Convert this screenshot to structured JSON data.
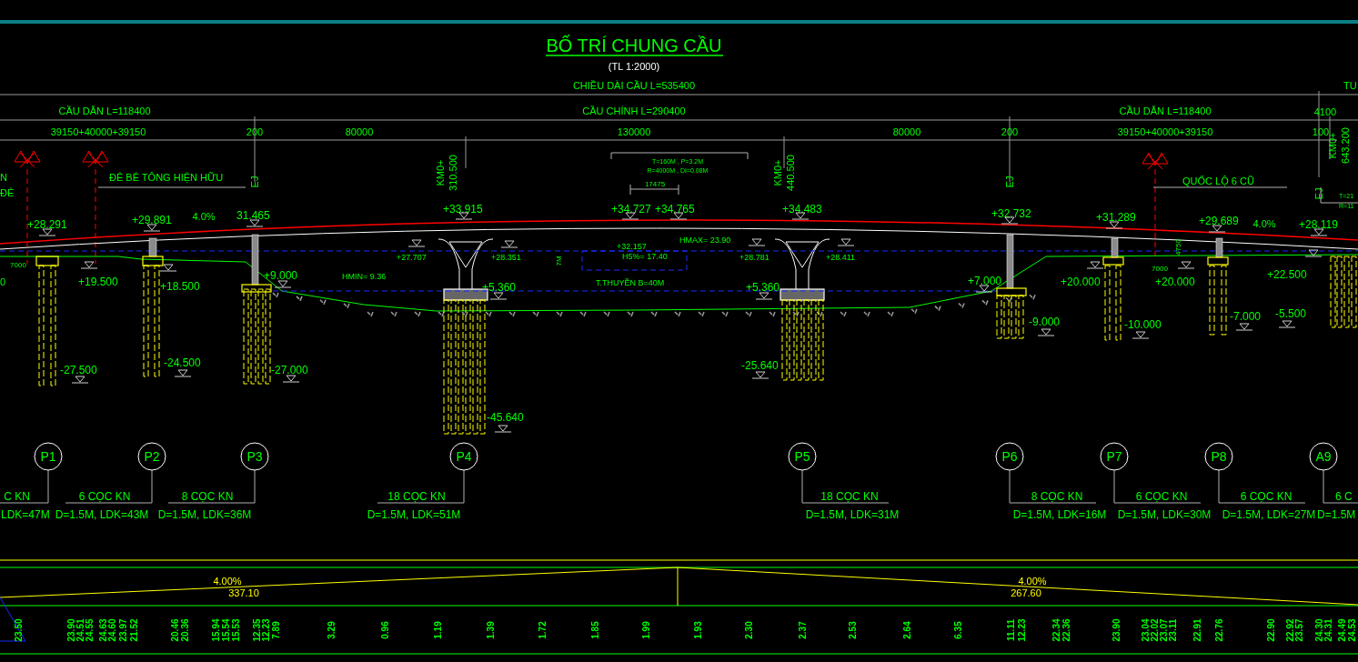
{
  "title": "BỐ TRÍ CHUNG CẦU",
  "scale": "(TL 1:2000)",
  "dimension_texts": [
    "CHIỀU DÀI CẦU L=535400",
    "TU",
    "CẦU DẪN L=118400",
    "CẦU CHÍNH L=290400",
    "CẦU DẪN L=118400",
    "4100",
    "39150+40000+39150",
    "200",
    "80000",
    "130000",
    "80000",
    "200",
    "39150+40000+39150",
    "100"
  ],
  "stations": [
    {
      "prefix": "KM0+",
      "value": "310.500"
    },
    {
      "prefix": "KM0+",
      "value": "440.500"
    },
    {
      "prefix": "KM0+",
      "value": "643.200"
    }
  ],
  "ej_labels": [
    "EJ",
    "EJ",
    "EJ"
  ],
  "notes": [
    "T=160M , P=3.2M",
    "R=4000M , DI=0.08M",
    "N",
    "ĐÊ BÊ TÔNG HIỆN HỮU",
    "17475",
    "QUỐC LỘ 6 CŨ",
    "ĐÊ",
    "T=21",
    "R=11",
    "4.0%",
    "4.0%",
    "HMAX= 23.90",
    "4750",
    "+32.157",
    "H5%= 17.40",
    "7M",
    "7000",
    "7000",
    "HMIN= 9.36",
    "0",
    "T.THUYỀN B=40M"
  ],
  "elevations": [
    "+28.291",
    "+29.891",
    "31.465",
    "+33.915",
    "+34.727",
    "+34.765",
    "+34.483",
    "+32.732",
    "+31.289",
    "+29.689",
    "+28.119",
    "+27.707",
    "+28.351",
    "+28.781",
    "+28.411",
    "+19.500",
    "+18.500",
    "+9.000",
    "+5.360",
    "+5.360",
    "+7.000",
    "+20.000",
    "+20.000",
    "+22.500",
    "-27.500",
    "-24.500",
    "-27.000",
    "-45.640",
    "-25.640",
    "-9.000",
    "-10.000",
    "-7.000",
    "-5.500"
  ],
  "piers": [
    {
      "label": "P1",
      "piles": "C KN",
      "spec": "LDK=47M"
    },
    {
      "label": "P2",
      "piles": "6 CỌC KN",
      "spec": "D=1.5M, LDK=43M"
    },
    {
      "label": "P3",
      "piles": "8 CỌC KN",
      "spec": "D=1.5M, LDK=36M"
    },
    {
      "label": "P4",
      "piles": "18 CỌC KN",
      "spec": "D=1.5M, LDK=51M"
    },
    {
      "label": "P5",
      "piles": "18 CỌC KN",
      "spec": "D=1.5M, LDK=31M"
    },
    {
      "label": "P6",
      "piles": "8 CỌC KN",
      "spec": "D=1.5M, LDK=16M"
    },
    {
      "label": "P7",
      "piles": "6 CỌC KN",
      "spec": "D=1.5M, LDK=30M"
    },
    {
      "label": "P8",
      "piles": "6 CỌC KN",
      "spec": "D=1.5M, LDK=27M"
    },
    {
      "label": "A9",
      "piles": "6 C",
      "spec": "D=1.5M"
    }
  ],
  "profile": [
    {
      "slope": "4.00%",
      "length": "337.10"
    },
    {
      "slope": "4.00%",
      "length": "267.60"
    }
  ],
  "ground_levels": [
    "23.50",
    "23.90",
    "24.51",
    "24.55",
    "24.63",
    "24.60",
    "23.97",
    "21.52",
    "20.46",
    "20.36",
    "15.94",
    "15.54",
    "15.53",
    "12.35",
    "12.23",
    "7.89",
    "3.29",
    "0.96",
    "1.19",
    "1.39",
    "1.72",
    "1.85",
    "1.99",
    "1.93",
    "2.30",
    "2.37",
    "2.53",
    "2.64",
    "6.35",
    "11.11",
    "12.23",
    "22.34",
    "22.36",
    "23.90",
    "23.04",
    "22.02",
    "23.07",
    "23.11",
    "22.91",
    "22.76",
    "22.90",
    "22.92",
    "23.57",
    "24.30",
    "24.31",
    "24.49",
    "24.53"
  ]
}
